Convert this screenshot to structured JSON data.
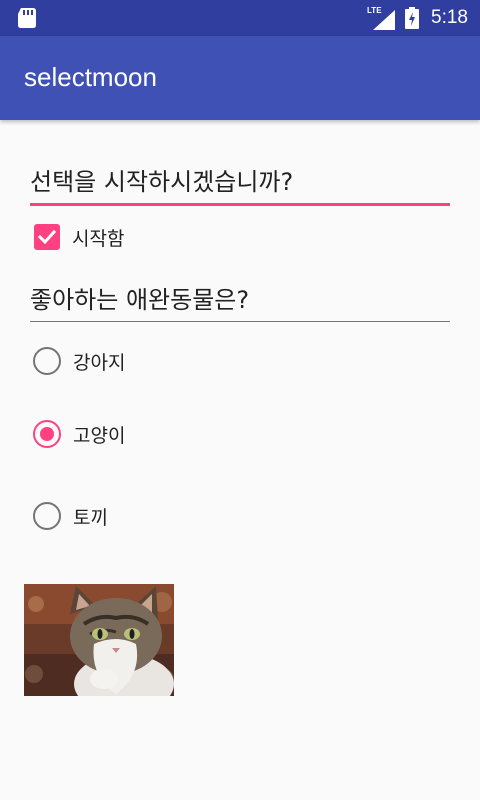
{
  "status_bar": {
    "network": "LTE",
    "time": "5:18",
    "icons": [
      "sd-card-icon",
      "lte-signal-icon",
      "battery-charging-icon"
    ]
  },
  "app_bar": {
    "title": "selectmoon"
  },
  "form": {
    "start_question": "선택을 시작하시겠습니까?",
    "start_checkbox": {
      "label": "시작함",
      "checked": true
    },
    "pet_question": "좋아하는 애완동물은?",
    "pet_options": [
      {
        "label": "강아지",
        "selected": false
      },
      {
        "label": "고양이",
        "selected": true
      },
      {
        "label": "토끼",
        "selected": false
      }
    ]
  },
  "image": {
    "subject": "cat"
  },
  "colors": {
    "primary": "#3f51b5",
    "primary_dark": "#303f9f",
    "accent": "#ff4081",
    "background": "#fafafa"
  }
}
